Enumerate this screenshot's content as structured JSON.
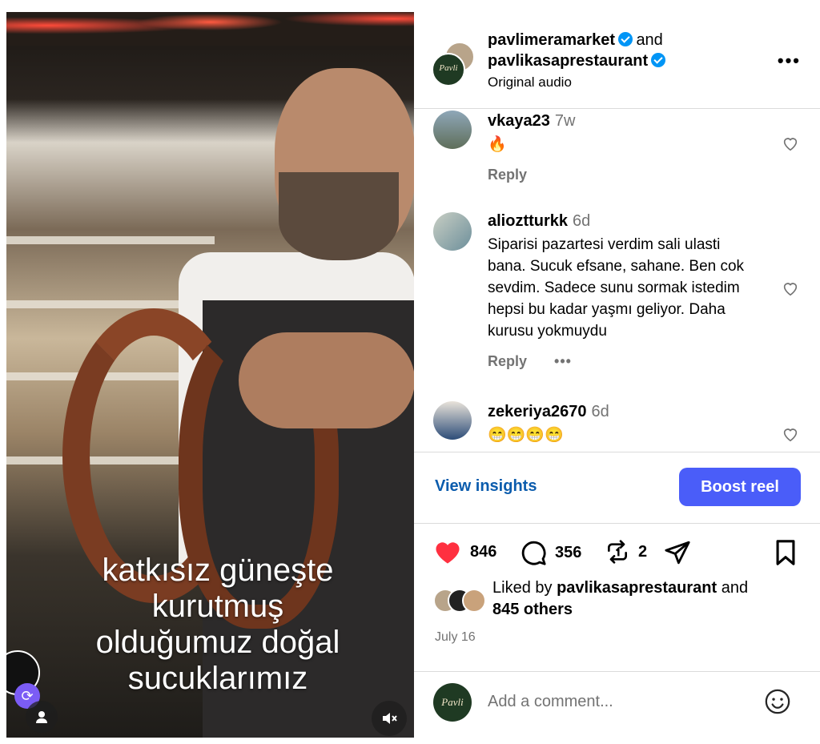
{
  "video": {
    "caption_lines": [
      "katkısız güneşte",
      "kurutmuş",
      "olduğumuz doğal",
      "sucuklarımız"
    ]
  },
  "header": {
    "user1": "pavlimeramarket",
    "and": "and",
    "user2": "pavlikasaprestaurant",
    "audio": "Original audio",
    "more": "•••"
  },
  "comments": [
    {
      "user": "vkaya23",
      "time": "7w",
      "text": "🔥",
      "reply": "Reply"
    },
    {
      "user": "alioztturkk",
      "time": "6d",
      "text": "Siparisi pazartesi verdim sali ulasti bana. Sucuk efsane, sahane. Ben cok sevdim. Sadece sunu sormak istedim hepsi bu kadar yaşmı geliyor. Daha kurusu yokmuydu",
      "reply": "Reply",
      "more": "•••"
    },
    {
      "user": "zekeriya2670",
      "time": "6d",
      "text": "😁😁😁😁"
    }
  ],
  "insights": {
    "view": "View insights",
    "boost": "Boost reel"
  },
  "actions": {
    "likes": "846",
    "comments": "356",
    "reposts": "2"
  },
  "liked_by": {
    "prefix": "Liked by ",
    "user": "pavlikasaprestaurant",
    "mid": " and",
    "others": "845 others"
  },
  "date": "July 16",
  "add_comment": {
    "placeholder": "Add a comment..."
  },
  "avatar_logo_text": "Pavli",
  "colors": {
    "like_red": "#ff3040",
    "boost_blue": "#4a5df9",
    "link_blue": "#0b5cad",
    "verified_blue": "#0095f6"
  }
}
